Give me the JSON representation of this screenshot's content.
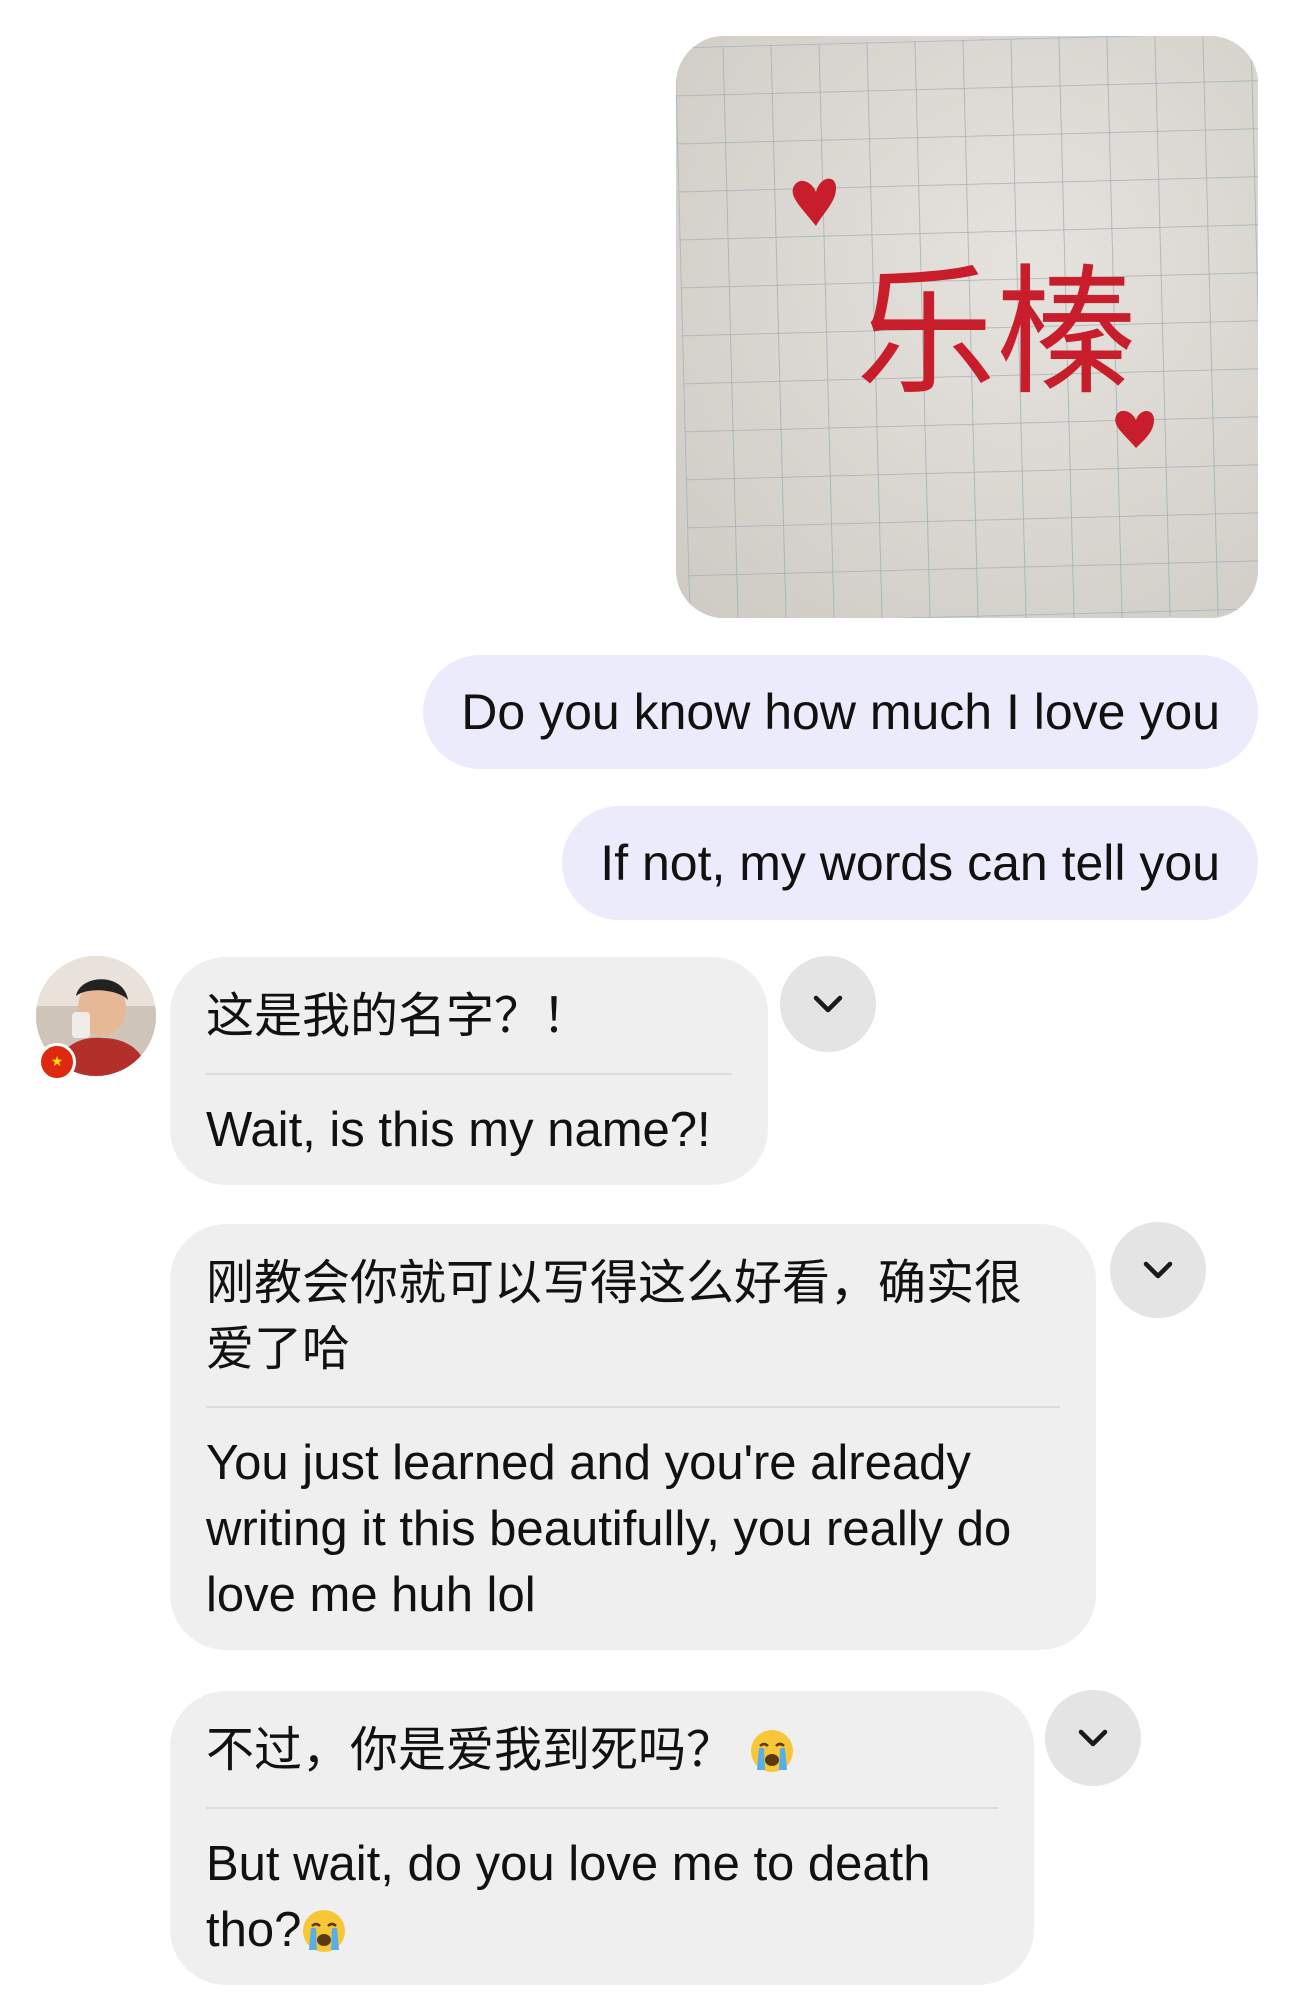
{
  "image_message": {
    "caption_text": "乐榛",
    "paper_color": "#d9d6d0",
    "ink_color": "#c81d2a"
  },
  "outgoing": [
    {
      "text": "Do you know how much I love you"
    },
    {
      "text": "If not, my words can tell you"
    }
  ],
  "contact": {
    "avatar_icon": "avatar-photo",
    "flag_icon": "china-flag-icon"
  },
  "incoming": [
    {
      "original": "这是我的名字？！",
      "translation": "Wait, is this my name?!"
    },
    {
      "original": "刚教会你就可以写得这么好看，确实很爱了哈",
      "translation": "You just learned and you're already writing it this beautifully, you really do love me huh lol"
    },
    {
      "original": "不过，你是爱我到死吗？",
      "translation": "But wait, do you love me to death tho?"
    }
  ],
  "colors": {
    "outgoing_bubble": "#ecebfb",
    "incoming_bubble": "#efefef",
    "chevron_button": "#e4e4e4"
  },
  "icons": {
    "chevron": "chevron-down-icon",
    "emoji": "loudly-crying-face-emoji"
  }
}
